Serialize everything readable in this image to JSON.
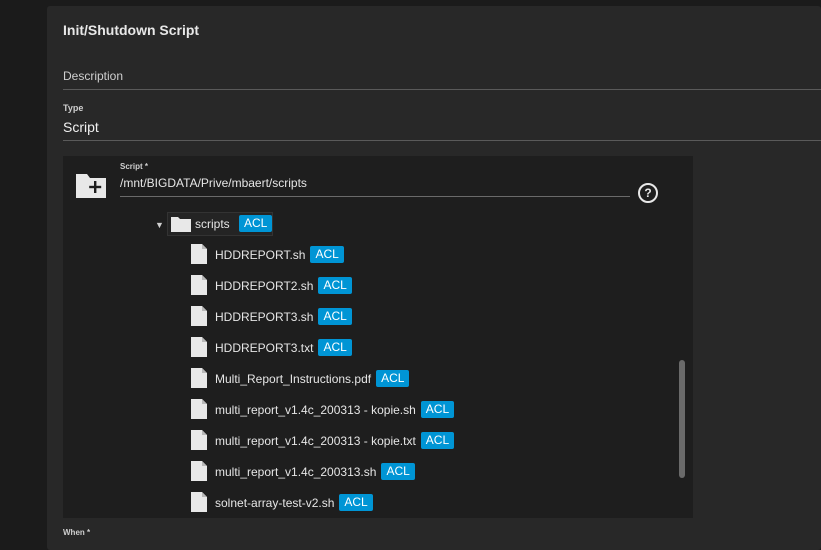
{
  "card": {
    "title": "Init/Shutdown Script"
  },
  "description": {
    "label": "Description"
  },
  "type": {
    "label": "Type",
    "value": "Script"
  },
  "script": {
    "label": "Script *",
    "value": "/mnt/BIGDATA/Prive/mbaert/scripts",
    "help": "?"
  },
  "tree": {
    "root": {
      "name": "scripts",
      "acl": "ACL",
      "expanded": true
    },
    "files": [
      {
        "name": "HDDREPORT.sh",
        "acl": "ACL"
      },
      {
        "name": "HDDREPORT2.sh",
        "acl": "ACL"
      },
      {
        "name": "HDDREPORT3.sh",
        "acl": "ACL"
      },
      {
        "name": "HDDREPORT3.txt",
        "acl": "ACL"
      },
      {
        "name": "Multi_Report_Instructions.pdf",
        "acl": "ACL"
      },
      {
        "name": "multi_report_v1.4c_200313 - kopie.sh",
        "acl": "ACL"
      },
      {
        "name": "multi_report_v1.4c_200313 - kopie.txt",
        "acl": "ACL"
      },
      {
        "name": "multi_report_v1.4c_200313.sh",
        "acl": "ACL"
      },
      {
        "name": "solnet-array-test-v2.sh",
        "acl": "ACL"
      }
    ]
  },
  "when": {
    "label": "When *"
  },
  "colors": {
    "acl_badge": "#0095d5",
    "card_bg": "#282828",
    "explorer_bg": "#1e1e1e"
  }
}
